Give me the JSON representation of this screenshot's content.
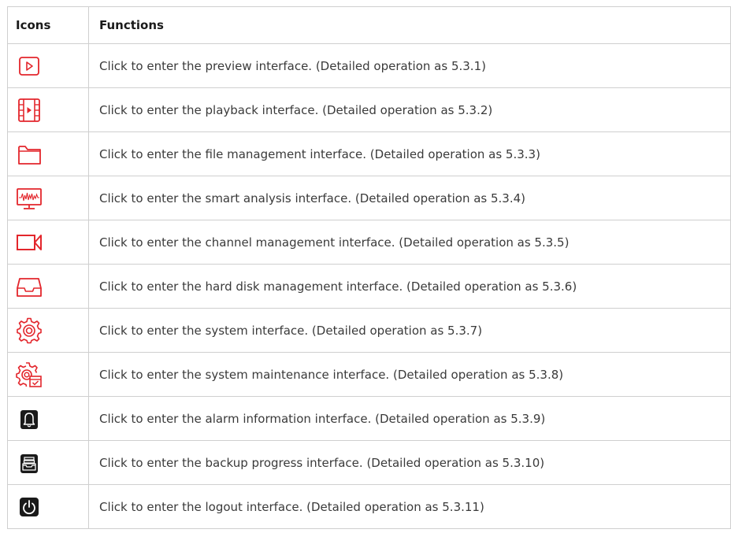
{
  "table": {
    "headers": [
      "Icons",
      "Functions"
    ],
    "rows": [
      {
        "icon": "preview-play-icon",
        "function": "Click to enter the preview interface. (Detailed operation as 5.3.1)"
      },
      {
        "icon": "playback-film-icon",
        "function": "Click to enter the playback interface. (Detailed operation as 5.3.2)"
      },
      {
        "icon": "folder-icon",
        "function": "Click to enter the file management interface. (Detailed operation as 5.3.3)"
      },
      {
        "icon": "monitor-waveform-icon",
        "function": "Click to enter the smart analysis interface. (Detailed operation as 5.3.4)"
      },
      {
        "icon": "video-camera-icon",
        "function": "Click to enter the channel management interface. (Detailed operation as 5.3.5)"
      },
      {
        "icon": "hard-disk-tray-icon",
        "function": "Click to enter the hard disk management interface. (Detailed operation as 5.3.6)"
      },
      {
        "icon": "gear-icon",
        "function": "Click to enter the system interface. (Detailed operation as 5.3.7)"
      },
      {
        "icon": "gear-maintenance-icon",
        "function": "Click to enter the system maintenance interface. (Detailed operation as 5.3.8)"
      },
      {
        "icon": "alarm-bell-icon",
        "function": "Click to enter the alarm information interface. (Detailed operation as 5.3.9)"
      },
      {
        "icon": "backup-tray-icon",
        "function": "Click to enter the backup progress interface. (Detailed operation as 5.3.10)"
      },
      {
        "icon": "power-icon",
        "function": "Click to enter the logout interface. (Detailed operation as 5.3.11)"
      }
    ]
  },
  "colors": {
    "icon_red": "#e3262c",
    "icon_dark": "#1a1a1a",
    "border": "#cfcfcf"
  }
}
